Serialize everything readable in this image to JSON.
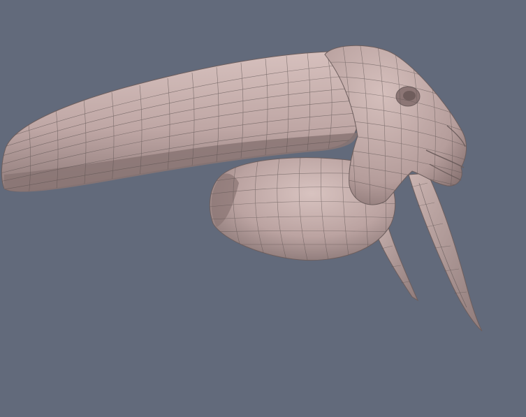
{
  "scene": {
    "background_color": "#626a7b",
    "mesh": {
      "surface_color": "#bda5a3",
      "highlight_color": "#d8c3c0",
      "shadow_color": "#7d6c6c",
      "wire_color": "#5d5352",
      "parts": [
        {
          "name": "upper-horn-mesh",
          "icon": "elongated-horn-shape"
        },
        {
          "name": "head-mesh",
          "icon": "head-shape"
        },
        {
          "name": "lower-sac-mesh",
          "icon": "rounded-sac-shape"
        },
        {
          "name": "tusk-mesh",
          "icon": "tusk-shape"
        }
      ]
    }
  }
}
